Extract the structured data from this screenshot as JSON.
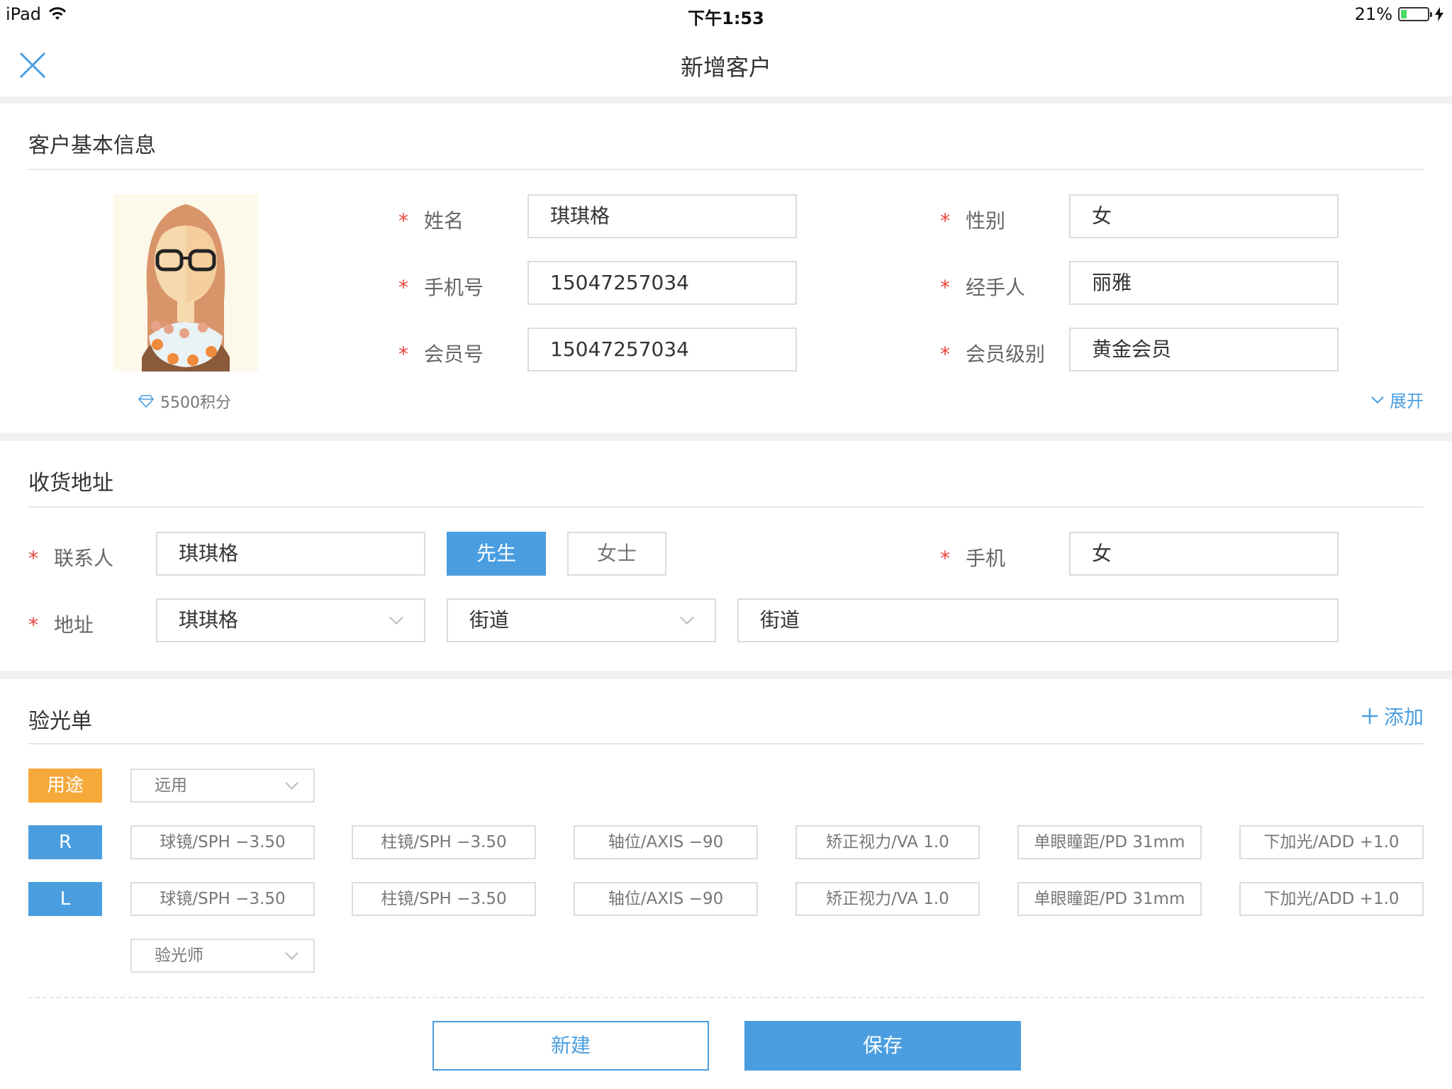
{
  "status_bar": {
    "device": "iPad",
    "time": "下午1:53",
    "battery_text": "21%",
    "battery_level": 0.21
  },
  "nav": {
    "title": "新增客户",
    "close_icon": "close-icon"
  },
  "basic_info": {
    "section_title": "客户基本信息",
    "points": "5500积分",
    "expand_label": "展开",
    "fields": {
      "name": {
        "label": "姓名",
        "value": "琪琪格"
      },
      "gender": {
        "label": "性别",
        "value": "女"
      },
      "phone": {
        "label": "手机号",
        "value": "15047257034"
      },
      "handler": {
        "label": "经手人",
        "value": "丽雅"
      },
      "member_no": {
        "label": "会员号",
        "value": "15047257034"
      },
      "member_level": {
        "label": "会员级别",
        "value": "黄金会员"
      }
    }
  },
  "address": {
    "section_title": "收货地址",
    "contact": {
      "label": "联系人",
      "value": "琪琪格"
    },
    "title_options": [
      "先生",
      "女士"
    ],
    "selected_title": "先生",
    "mobile": {
      "label": "手机",
      "value": "女"
    },
    "addr": {
      "label": "地址",
      "province": "琪琪格",
      "street_select": "街道",
      "street_detail": "街道"
    }
  },
  "prescription": {
    "section_title": "验光单",
    "add_label": "添加",
    "purpose": {
      "tag": "用途",
      "value": "远用"
    },
    "rows": [
      {
        "tag": "R",
        "cells": [
          "球镜/SPH  −3.50",
          "柱镜/SPH  −3.50",
          "轴位/AXIS  −90",
          "矫正视力/VA  1.0",
          "单眼瞳距/PD  31mm",
          "下加光/ADD  +1.0"
        ]
      },
      {
        "tag": "L",
        "cells": [
          "球镜/SPH  −3.50",
          "柱镜/SPH  −3.50",
          "轴位/AXIS  −90",
          "矫正视力/VA  1.0",
          "单眼瞳距/PD  31mm",
          "下加光/ADD  +1.0"
        ]
      }
    ],
    "optometrist": "验光师"
  },
  "actions": {
    "new_label": "新建",
    "save_label": "保存"
  },
  "colors": {
    "accent": "#4a9ee0",
    "required": "#e8453c",
    "purpose_tag": "#f5a93a"
  }
}
